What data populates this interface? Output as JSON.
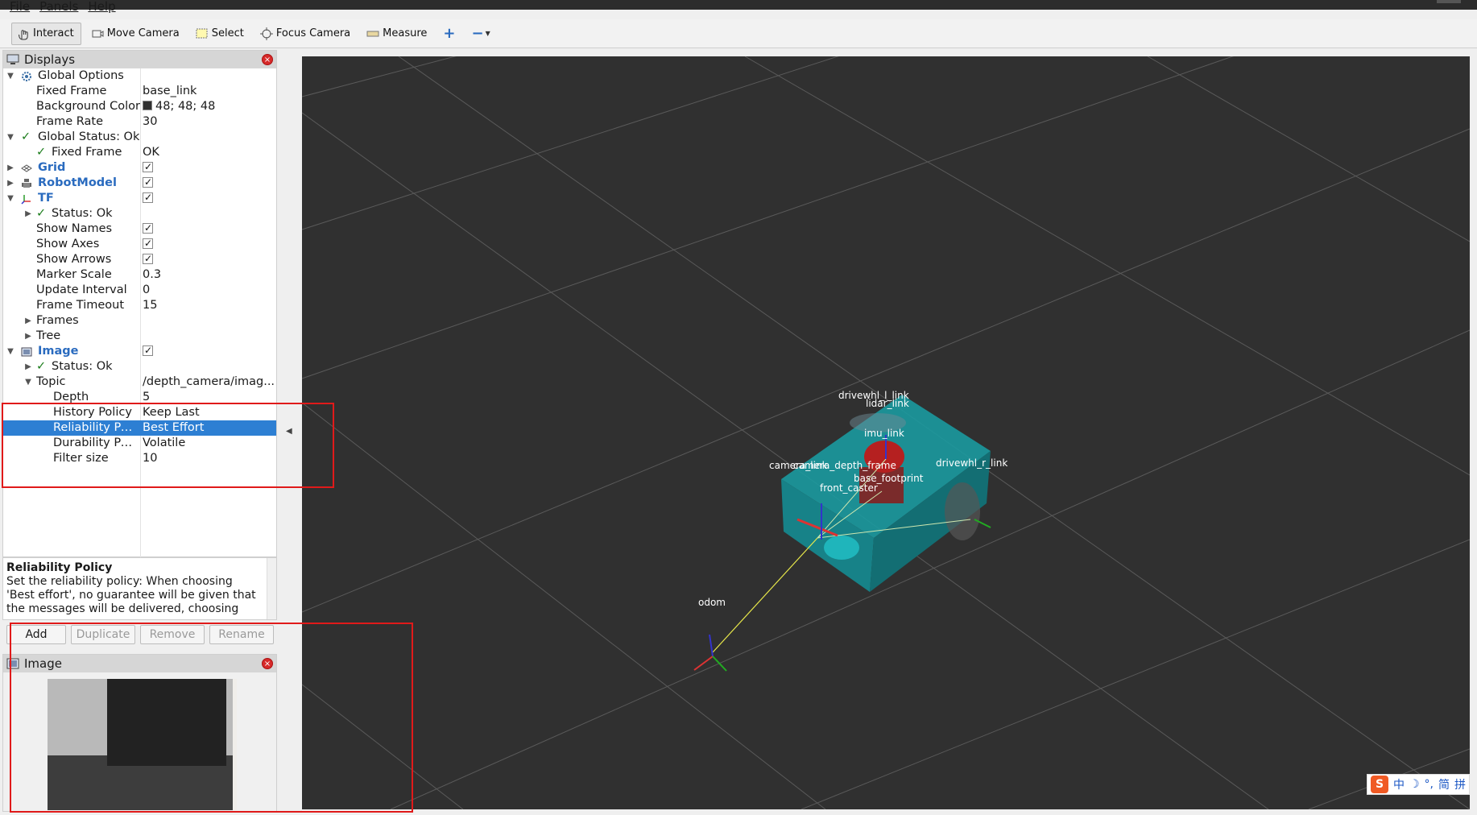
{
  "menu": [
    "File",
    "Panels",
    "Help"
  ],
  "toolbar": {
    "interact": "Interact",
    "move_camera": "Move Camera",
    "select": "Select",
    "focus_camera": "Focus Camera",
    "measure": "Measure",
    "plus": "+",
    "minus": "−"
  },
  "displays": {
    "title": "Displays",
    "rows": {
      "global_options": "Global Options",
      "fixed_frame_label": "Fixed Frame",
      "fixed_frame_value": "base_link",
      "bg_color_label": "Background Color",
      "bg_color_value": "48; 48; 48",
      "frame_rate_label": "Frame Rate",
      "frame_rate_value": "30",
      "global_status": "Global Status: Ok",
      "gs_fixed_frame": "Fixed Frame",
      "gs_fixed_frame_value": "OK",
      "grid": "Grid",
      "robotmodel": "RobotModel",
      "tf": "TF",
      "tf_status": "Status: Ok",
      "show_names": "Show Names",
      "show_axes": "Show Axes",
      "show_arrows": "Show Arrows",
      "marker_scale_label": "Marker Scale",
      "marker_scale_value": "0.3",
      "update_interval_label": "Update Interval",
      "update_interval_value": "0",
      "frame_timeout_label": "Frame Timeout",
      "frame_timeout_value": "15",
      "frames": "Frames",
      "tree": "Tree",
      "image": "Image",
      "image_status": "Status: Ok",
      "topic_label": "Topic",
      "topic_value": "/depth_camera/imag...",
      "depth_label": "Depth",
      "depth_value": "5",
      "history_label": "History Policy",
      "history_value": "Keep Last",
      "reliability_label": "Reliability Po...",
      "reliability_value": "Best Effort",
      "durability_label": "Durability Po...",
      "durability_value": "Volatile",
      "filter_label": "Filter size",
      "filter_value": "10"
    }
  },
  "description": {
    "title": "Reliability Policy",
    "text": "Set the reliability policy: When choosing 'Best effort', no guarantee will be given that the messages will be delivered, choosing"
  },
  "buttons": {
    "add": "Add",
    "duplicate": "Duplicate",
    "remove": "Remove",
    "rename": "Rename"
  },
  "image_panel": {
    "title": "Image"
  },
  "scene_labels": {
    "drivewhl_l": "drivewhl_l_link",
    "lidar": "lidar_link",
    "imu": "imu_link",
    "camera": "camera_link",
    "camera_depth": "camera_depth_frame",
    "drivewhl_r": "drivewhl_r_link",
    "base_footprint": "base_footprint",
    "front_caster": "front_caster",
    "odom": "odom"
  },
  "tray": [
    "中",
    "°,",
    "简",
    "拼"
  ],
  "colors": {
    "background": "#303030",
    "selection": "#2d7fd3",
    "robot_body": "#1a8f8f",
    "highlight_box": "#e01a1a"
  }
}
